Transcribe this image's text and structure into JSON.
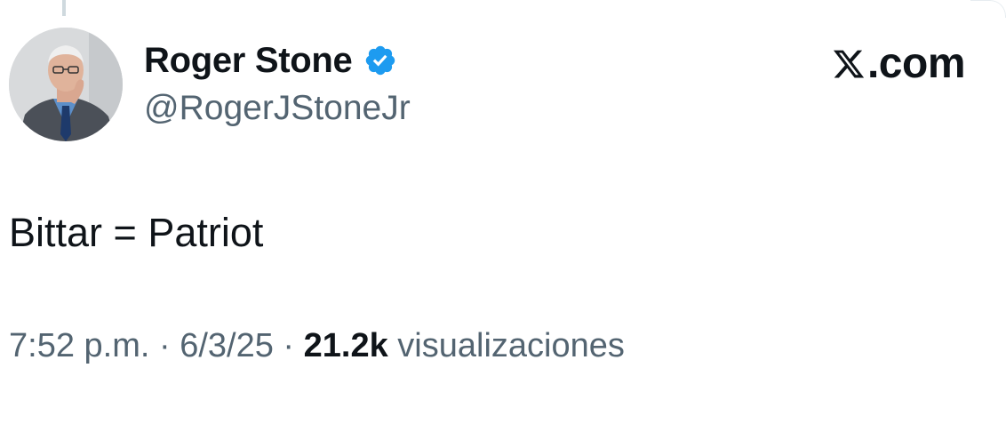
{
  "author": {
    "display_name": "Roger Stone",
    "handle": "@RogerJStoneJr",
    "verified": true,
    "verified_color": "#1d9bf0",
    "avatar_icon": "profile-photo"
  },
  "brand": {
    "text": ".com",
    "logo_icon": "x-logo-icon"
  },
  "tweet": {
    "text": "Bittar = Patriot"
  },
  "meta": {
    "time": "7:52 p.m.",
    "separator": " · ",
    "date": "6/3/25",
    "views_count": "21.2k",
    "views_label": "visualizaciones"
  },
  "colors": {
    "primary_text": "#0f1419",
    "secondary_text": "#536471"
  }
}
